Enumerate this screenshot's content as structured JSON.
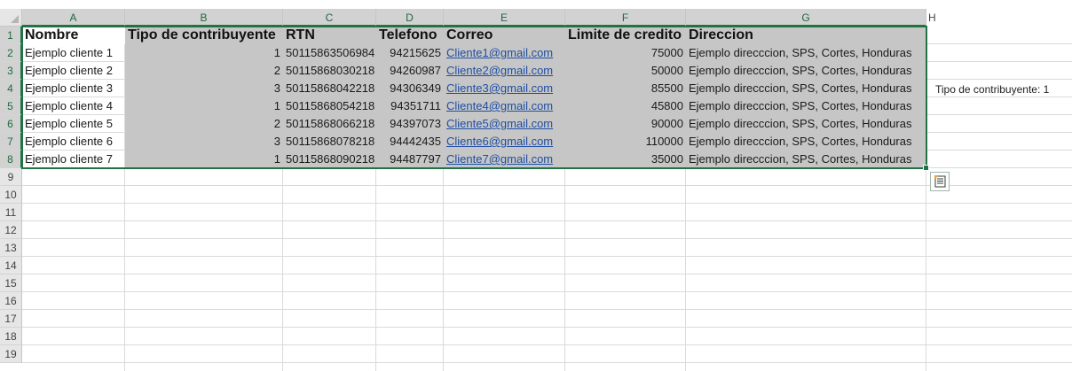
{
  "columns": [
    "A",
    "B",
    "C",
    "D",
    "E",
    "F",
    "G",
    "H"
  ],
  "rows": [
    "1",
    "2",
    "3",
    "4",
    "5",
    "6",
    "7",
    "8",
    "9",
    "10",
    "11",
    "12",
    "13",
    "14",
    "15",
    "16",
    "17",
    "18",
    "19"
  ],
  "table": {
    "headers": [
      "Nombre",
      "Tipo de contribuyente",
      "RTN",
      "Telefono",
      "Correo",
      "Limite de credito",
      "Direccion"
    ],
    "records": [
      [
        "Ejemplo cliente 1",
        "1",
        "50115863506984",
        "94215625",
        "Cliente1@gmail.com",
        "75000",
        "Ejemplo direcccion, SPS, Cortes, Honduras"
      ],
      [
        "Ejemplo cliente 2",
        "2",
        "50115868030218",
        "94260987",
        "Cliente2@gmail.com",
        "50000",
        "Ejemplo direcccion, SPS, Cortes, Honduras"
      ],
      [
        "Ejemplo cliente 3",
        "3",
        "50115868042218",
        "94306349",
        "Cliente3@gmail.com",
        "85500",
        "Ejemplo direcccion, SPS, Cortes, Honduras"
      ],
      [
        "Ejemplo cliente 4",
        "1",
        "50115868054218",
        "94351711",
        "Cliente4@gmail.com",
        "45800",
        "Ejemplo direcccion, SPS, Cortes, Honduras"
      ],
      [
        "Ejemplo cliente 5",
        "2",
        "50115868066218",
        "94397073",
        "Cliente5@gmail.com",
        "90000",
        "Ejemplo direcccion, SPS, Cortes, Honduras"
      ],
      [
        "Ejemplo cliente 6",
        "3",
        "50115868078218",
        "94442435",
        "Cliente6@gmail.com",
        "110000",
        "Ejemplo direcccion, SPS, Cortes, Honduras"
      ],
      [
        "Ejemplo cliente 7",
        "1",
        "50115868090218",
        "94487797",
        "Cliente7@gmail.com",
        "35000",
        "Ejemplo direcccion, SPS, Cortes, Honduras"
      ]
    ]
  },
  "tooltip_text": "Tipo de contribuyente:  1",
  "quick_analysis_icon": "quick-analysis-icon",
  "colors": {
    "selection_border": "#217346",
    "selection_fill": "#c6c6c6",
    "link": "#1f4fa3"
  }
}
